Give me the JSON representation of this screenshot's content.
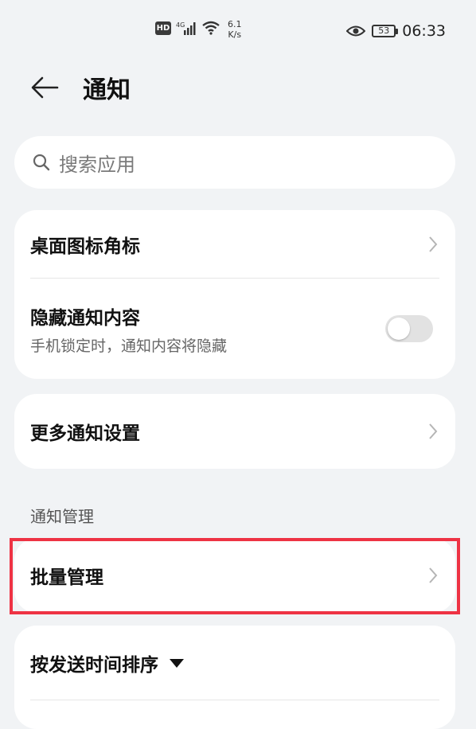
{
  "status_bar": {
    "hd_label": "HD",
    "signal_label": "4G",
    "net_speed_value": "6.1",
    "net_speed_unit": "K/s",
    "battery_level": "53",
    "time": "06:33"
  },
  "header": {
    "title": "通知"
  },
  "search": {
    "placeholder": "搜索应用"
  },
  "group1": {
    "items": [
      {
        "label": "桌面图标角标"
      },
      {
        "label": "隐藏通知内容",
        "sublabel": "手机锁定时，通知内容将隐藏",
        "toggle_on": false
      }
    ]
  },
  "group2": {
    "items": [
      {
        "label": "更多通知设置"
      }
    ]
  },
  "section": {
    "label": "通知管理"
  },
  "group3": {
    "items": [
      {
        "label": "批量管理"
      }
    ]
  },
  "group4": {
    "items": [
      {
        "label": "按发送时间排序"
      }
    ]
  },
  "colors": {
    "background": "#f1f3f5",
    "card": "#ffffff",
    "highlight": "#ee3344",
    "toggle_off": "#e2e2e2"
  }
}
